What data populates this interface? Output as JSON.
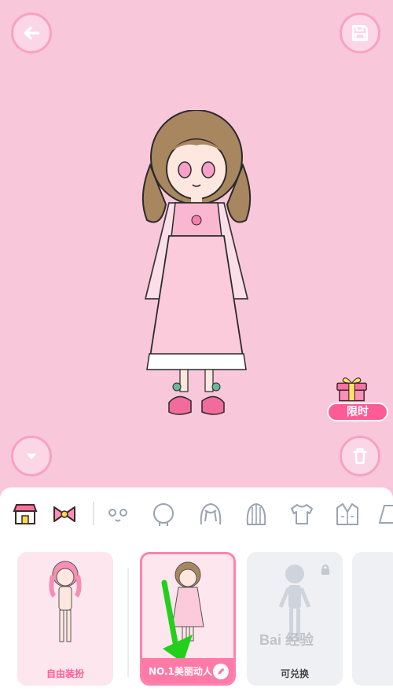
{
  "colors": {
    "stage_bg": "#f9c7da",
    "accent_pink": "#ff7aa6",
    "badge_pink": "#ff5b95"
  },
  "icons": {
    "back": "arrow-left-icon",
    "save": "floppy-disk-icon",
    "collapse": "chevron-down-icon",
    "delete": "trash-icon"
  },
  "gift": {
    "badge_label": "限时"
  },
  "categories": [
    {
      "name": "shop-icon"
    },
    {
      "name": "bow-icon"
    },
    {
      "name": "face-icon"
    },
    {
      "name": "head-icon"
    },
    {
      "name": "hair-icon"
    },
    {
      "name": "back-hair-icon"
    },
    {
      "name": "shirt-icon"
    },
    {
      "name": "jacket-icon"
    },
    {
      "name": "skirt-icon"
    }
  ],
  "outfits": [
    {
      "label": "自由装扮",
      "state": "free"
    },
    {
      "label": "NO.1美丽动人",
      "state": "selected"
    },
    {
      "label": "可兑换",
      "state": "locked"
    }
  ],
  "watermark": {
    "text": "Bai 经验"
  }
}
